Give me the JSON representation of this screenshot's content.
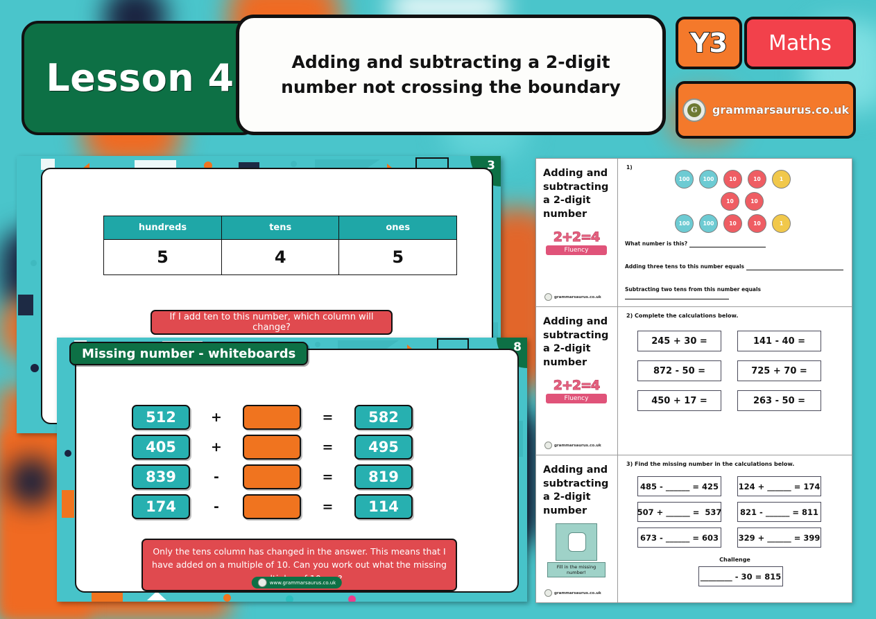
{
  "header": {
    "lesson_label": "Lesson 4",
    "title": "Adding and subtracting a 2-digit number not crossing the boundary",
    "year_badge": "Y3",
    "subject_badge": "Maths",
    "site_badge": "grammarsaurus.co.uk",
    "logo_letter": "G"
  },
  "colors": {
    "teal_bg": "#4ac5cb",
    "green": "#0d7045",
    "orange": "#f4792b",
    "red": "#e04a4f",
    "table_header_teal": "#1fa7a7",
    "numbox_teal": "#27b0b0",
    "blank_orange": "#f0741f"
  },
  "slides": [
    {
      "number": "3",
      "table": {
        "headers": [
          "hundreds",
          "tens",
          "ones"
        ],
        "values": [
          "5",
          "4",
          "5"
        ]
      },
      "question": "If I add ten to this number, which column will change?"
    },
    {
      "number": "8",
      "title": "Missing number - whiteboards",
      "rows": [
        {
          "left": "512",
          "op": "+",
          "blank": "",
          "eq": "=",
          "right": "582"
        },
        {
          "left": "405",
          "op": "+",
          "blank": "",
          "eq": "=",
          "right": "495"
        },
        {
          "left": "839",
          "op": "-",
          "blank": "",
          "eq": "=",
          "right": "819"
        },
        {
          "left": "174",
          "op": "-",
          "blank": "",
          "eq": "=",
          "right": "114"
        }
      ],
      "note": "Only the tens column has changed in the answer. This means that I have added on a multiple of 10. Can you work out what the missing multiples of 10 are?",
      "footer": "www.grammarsaurus.co.uk"
    }
  ],
  "worksheet": {
    "side_title": "Adding and subtracting a 2-digit number",
    "footer_logo_text": "grammarsaurus.co.uk",
    "rows": [
      {
        "icon_name": "fluency-icon",
        "icon_sum": "2+2=4",
        "icon_label": "Fluency",
        "qnum": "1)",
        "counters": [
          [
            "100",
            "100",
            "10",
            "10",
            "1"
          ],
          [
            "",
            "",
            "10",
            "10",
            ""
          ],
          [
            "100",
            "100",
            "10",
            "10",
            "1"
          ]
        ],
        "questions": [
          "What number is this? ",
          "Adding three tens to this number equals ",
          "Subtracting two tens from this number equals "
        ]
      },
      {
        "icon_name": "fluency-icon",
        "icon_sum": "2+2=4",
        "icon_label": "Fluency",
        "instruction": "2) Complete the calculations below.",
        "calculations": [
          "245 + 30 =",
          "141 - 40 =",
          "872 - 50 =",
          "725 + 70 =",
          "450 + 17 =",
          "263 - 50 ="
        ]
      },
      {
        "icon_name": "puzzle-icon",
        "icon_label": "Fill in the missing number!",
        "instruction": "3) Find the missing number in the calculations below.",
        "missing": [
          "485 - ______ = 425",
          "124 + ______ = 174",
          "507 + ______ =  537",
          "821 - ______ = 811",
          "673 - ______ = 603",
          "329 + ______ = 399"
        ],
        "challenge_label": "Challenge",
        "challenge": "________ - 30 = 815"
      }
    ]
  }
}
